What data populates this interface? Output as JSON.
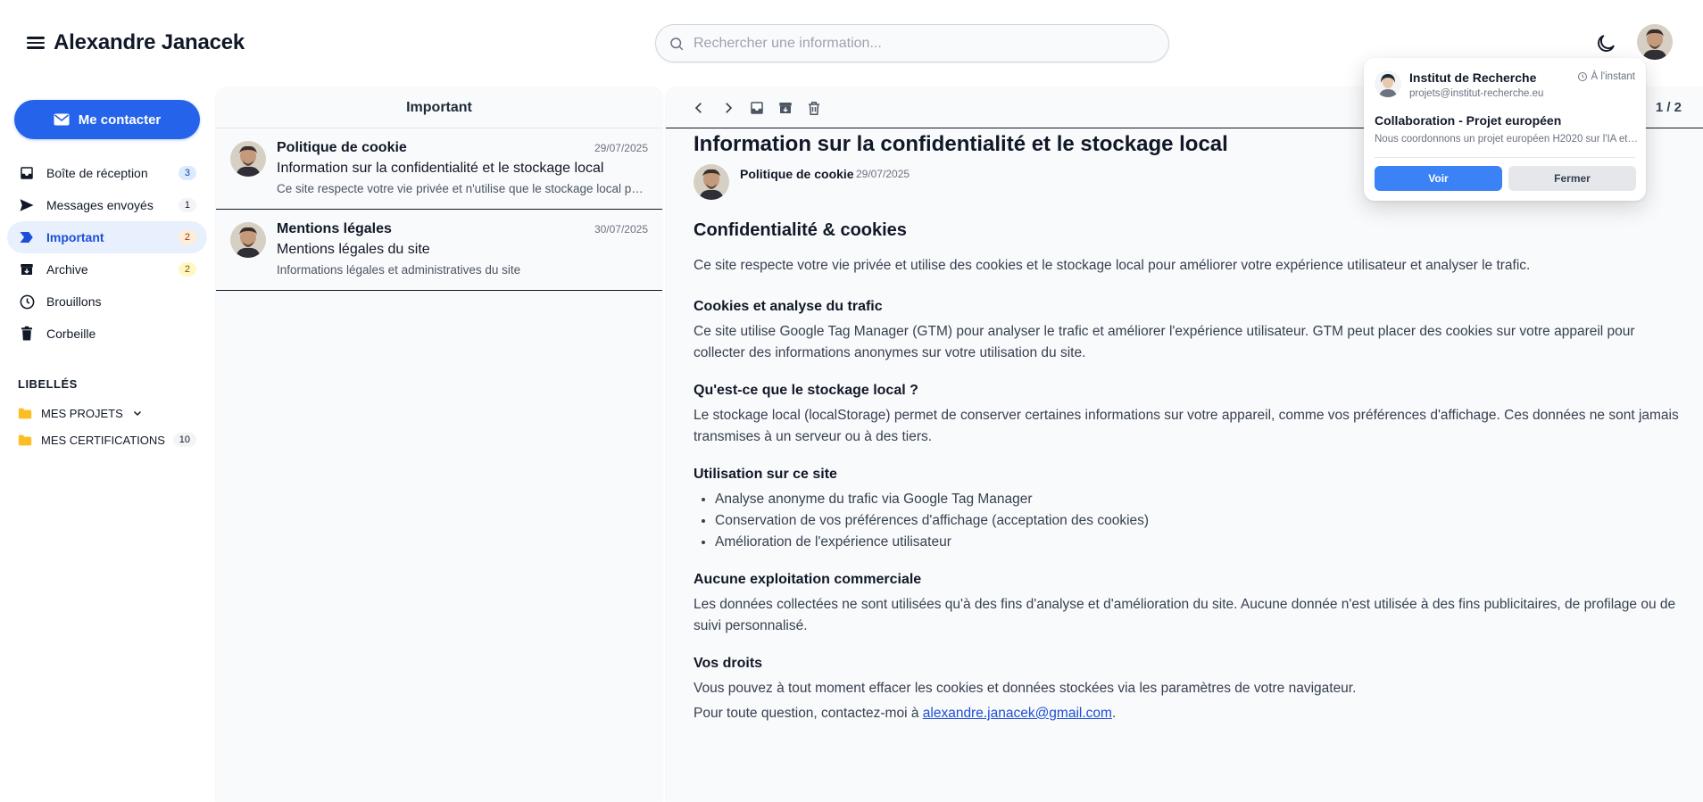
{
  "header": {
    "title": "Alexandre Janacek",
    "search_placeholder": "Rechercher une information..."
  },
  "sidebar": {
    "contact_button": "Me contacter",
    "items": [
      {
        "label": "Boîte de réception",
        "count": "3",
        "icon": "inbox-icon"
      },
      {
        "label": "Messages envoyés",
        "count": "1",
        "icon": "send-icon"
      },
      {
        "label": "Important",
        "count": "2",
        "icon": "important-icon"
      },
      {
        "label": "Archive",
        "count": "2",
        "icon": "archive-icon"
      },
      {
        "label": "Brouillons",
        "count": "",
        "icon": "clock-icon"
      },
      {
        "label": "Corbeille",
        "count": "",
        "icon": "trash-icon"
      }
    ],
    "labels_title": "LIBELLÉS",
    "labels": [
      {
        "label": "MES PROJETS",
        "count": ""
      },
      {
        "label": "MES CERTIFICATIONS",
        "count": "10"
      }
    ]
  },
  "list": {
    "header": "Important",
    "mails": [
      {
        "from": "Politique de cookie",
        "date": "29/07/2025",
        "subject": "Information sur la confidentialité et le stockage local",
        "preview": "Ce site respecte votre vie privée et n'utilise que le stockage local pour améliorer votre expérience."
      },
      {
        "from": "Mentions légales",
        "date": "30/07/2025",
        "subject": "Mentions légales du site",
        "preview": "Informations légales et administratives du site"
      }
    ]
  },
  "reader": {
    "pager": "1 / 2",
    "title": "Information sur la confidentialité et le stockage local",
    "sender": "Politique de cookie",
    "date": "29/07/2025",
    "heading": "Confidentialité & cookies",
    "intro": "Ce site respecte votre vie privée et utilise des cookies et le stockage local pour améliorer votre expérience utilisateur et analyser le trafic.",
    "s1_title": "Cookies et analyse du trafic",
    "s1_text": "Ce site utilise Google Tag Manager (GTM) pour analyser le trafic et améliorer l'expérience utilisateur. GTM peut placer des cookies sur votre appareil pour collecter des informations anonymes sur votre utilisation du site.",
    "s2_title": "Qu'est-ce que le stockage local ?",
    "s2_text": "Le stockage local (localStorage) permet de conserver certaines informations sur votre appareil, comme vos préférences d'affichage. Ces données ne sont jamais transmises à un serveur ou à des tiers.",
    "s3_title": "Utilisation sur ce site",
    "s3_items": [
      "Analyse anonyme du trafic via Google Tag Manager",
      "Conservation de vos préférences d'affichage (acceptation des cookies)",
      "Amélioration de l'expérience utilisateur"
    ],
    "s4_title": "Aucune exploitation commerciale",
    "s4_text": "Les données collectées ne sont utilisées qu'à des fins d'analyse et d'amélioration du site. Aucune donnée n'est utilisée à des fins publicitaires, de profilage ou de suivi personnalisé.",
    "s5_title": "Vos droits",
    "s5_text": "Vous pouvez à tout moment effacer les cookies et données stockées via les paramètres de votre navigateur.",
    "contact_prefix": "Pour toute question, contactez-moi à ",
    "contact_email": "alexandre.janacek@gmail.com",
    "contact_suffix": "."
  },
  "notification": {
    "from": "Institut de Recherche",
    "email": "projets@institut-recherche.eu",
    "time": "À l'instant",
    "subject": "Collaboration - Projet européen",
    "preview": "Nous coordonnons un projet européen H2020 sur l'IA et recherchons des partenaires.",
    "view_button": "Voir",
    "close_button": "Fermer"
  },
  "colors": {
    "accent": "#2563eb",
    "active_bg": "#e8f0fe",
    "panel_bg": "#f9fafb"
  }
}
